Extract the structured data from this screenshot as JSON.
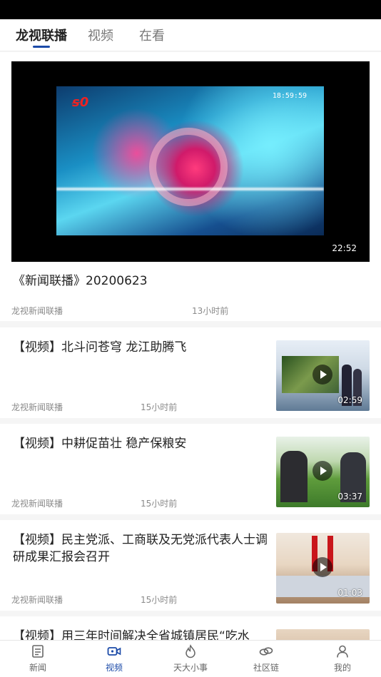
{
  "top_tabs": [
    {
      "label": "龙视联播",
      "active": true
    },
    {
      "label": "视频",
      "active": false
    },
    {
      "label": "在看",
      "active": false
    }
  ],
  "featured": {
    "title": "《新闻联播》20200623",
    "source": "龙视新闻联播",
    "time_ago": "13小时前",
    "duration": "22:52",
    "frame_clock": "18:59:59"
  },
  "items": [
    {
      "title": "【视频】北斗问苍穹 龙江助腾飞",
      "source": "龙视新闻联播",
      "time_ago": "15小时前",
      "duration": "02:59"
    },
    {
      "title": "【视频】中耕促苗壮 稳产保粮安",
      "source": "龙视新闻联播",
      "time_ago": "15小时前",
      "duration": "03:37"
    },
    {
      "title": "【视频】民主党派、工商联及无党派代表人士调研成果汇报会召开",
      "source": "龙视新闻联播",
      "time_ago": "15小时前",
      "duration": "01:03"
    },
    {
      "title": "【视频】用三年时间解决全省城镇居民“吃水"
    }
  ],
  "bottom_nav": [
    {
      "label": "新闻",
      "icon": "news-icon",
      "active": false
    },
    {
      "label": "视频",
      "icon": "video-camera-icon",
      "active": true
    },
    {
      "label": "天大小事",
      "icon": "flame-icon",
      "active": false
    },
    {
      "label": "社区链",
      "icon": "link-icon",
      "active": false
    },
    {
      "label": "我的",
      "icon": "person-icon",
      "active": false
    }
  ],
  "colors": {
    "accent": "#1b4aa8",
    "meta_text": "#8a8a8a"
  }
}
